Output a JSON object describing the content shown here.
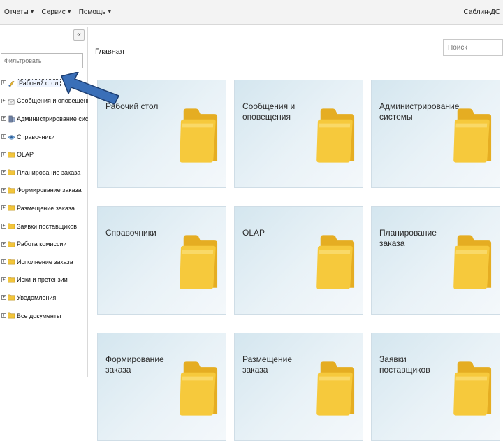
{
  "menu": {
    "items": [
      {
        "label": "Отчеты"
      },
      {
        "label": "Сервис"
      },
      {
        "label": "Помощь"
      }
    ],
    "user": "Саблин-ДС"
  },
  "sidebar": {
    "collapse_glyph": "«",
    "filter_placeholder": "Фильтровать",
    "tree": [
      {
        "label": "Рабочий стол",
        "icon": "desktop-icon",
        "selected": true
      },
      {
        "label": "Сообщения и оповещения",
        "icon": "messages-icon"
      },
      {
        "label": "Администрирование системы",
        "icon": "admin-icon"
      },
      {
        "label": "Справочники",
        "icon": "reference-icon"
      },
      {
        "label": "OLAP",
        "icon": "folder-icon"
      },
      {
        "label": "Планирование заказа",
        "icon": "folder-icon"
      },
      {
        "label": "Формирование заказа",
        "icon": "folder-icon"
      },
      {
        "label": "Размещение заказа",
        "icon": "folder-icon"
      },
      {
        "label": "Заявки поставщиков",
        "icon": "folder-icon"
      },
      {
        "label": "Работа комиссии",
        "icon": "folder-icon"
      },
      {
        "label": "Исполнение заказа",
        "icon": "folder-icon"
      },
      {
        "label": "Иски и претензии",
        "icon": "folder-icon"
      },
      {
        "label": "Уведомления",
        "icon": "folder-icon"
      },
      {
        "label": "Все документы",
        "icon": "folder-icon"
      }
    ]
  },
  "main": {
    "title": "Главная",
    "search_placeholder": "Поиск",
    "tiles": [
      {
        "label": "Рабочий стол"
      },
      {
        "label": "Сообщения и оповещения"
      },
      {
        "label": "Администрирование системы"
      },
      {
        "label": "Справочники"
      },
      {
        "label": "OLAP"
      },
      {
        "label": "Планирование заказа"
      },
      {
        "label": "Формирование заказа"
      },
      {
        "label": "Размещение заказа"
      },
      {
        "label": "Заявки поставщиков"
      }
    ]
  },
  "colors": {
    "arrow_fill": "#3a6fb8",
    "arrow_stroke": "#1e3f72",
    "folder_yellow": "#f5c83a"
  }
}
